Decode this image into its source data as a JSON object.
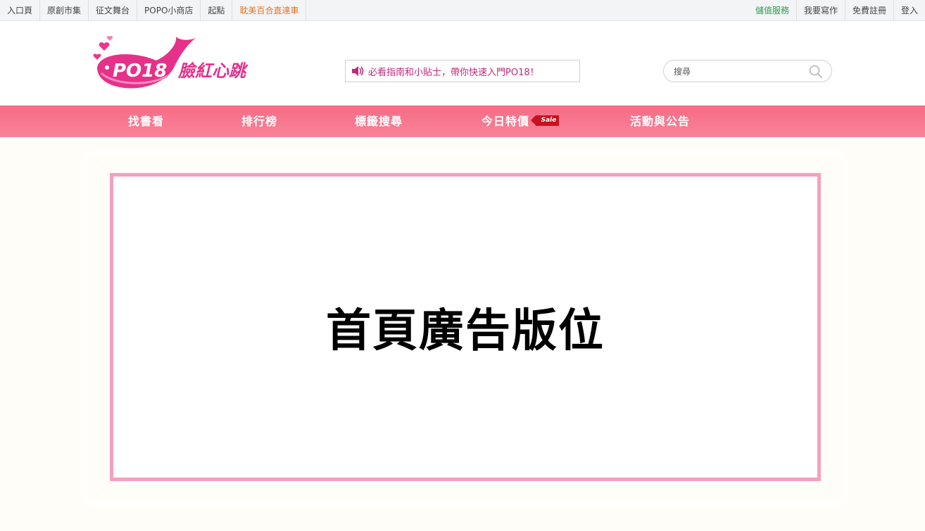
{
  "topbar": {
    "left": [
      "入口頁",
      "原創市集",
      "征文舞台",
      "POPO小商店",
      "起點",
      "耽美百合直達車"
    ],
    "right": [
      "儲值服務",
      "我要寫作",
      "免費註冊",
      "登入"
    ],
    "colors": {
      "orange": "#e0762a",
      "green": "#2f9a4a"
    }
  },
  "header": {
    "logo": {
      "brand": "PO18",
      "tagline": "臉紅心跳"
    },
    "notice": "必看指南和小貼士，帶你快速入門PO18！",
    "search_placeholder": "搜尋"
  },
  "nav": {
    "items": [
      "找書看",
      "排行榜",
      "標籤搜尋",
      "今日特價",
      "活動與公告"
    ],
    "sale_badge": "Sale",
    "color": "#f7768e"
  },
  "ad": {
    "text": "首頁廣告版位",
    "border_color": "#f5a0bd"
  }
}
